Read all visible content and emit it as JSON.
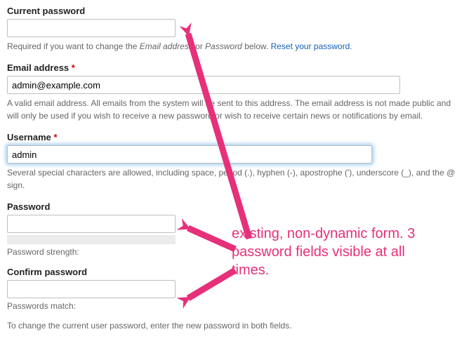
{
  "form": {
    "currentPassword": {
      "label": "Current password",
      "value": "",
      "desc_prefix": "Required if you want to change the ",
      "desc_em1": "Email address",
      "desc_mid": " or ",
      "desc_em2": "Password",
      "desc_suffix": " below. ",
      "resetLink": "Reset your password",
      "resetTail": "."
    },
    "email": {
      "label": "Email address",
      "value": "admin@example.com",
      "desc": "A valid email address. All emails from the system will be sent to this address. The email address is not made public and will only be used if you wish to receive a new password or wish to receive certain news or notifications by email."
    },
    "username": {
      "label": "Username",
      "value": "admin",
      "desc": "Several special characters are allowed, including space, period (.), hyphen (-), apostrophe ('), underscore (_), and the @ sign."
    },
    "password": {
      "label": "Password",
      "value": "",
      "strengthLabel": "Password strength:"
    },
    "confirm": {
      "label": "Confirm password",
      "value": "",
      "matchLabel": "Passwords match:"
    },
    "finalNote": "To change the current user password, enter the new password in both fields.",
    "requiredMarker": "*"
  },
  "annotation": {
    "text": "existing, non-dynamic form. 3 password fields visible at all times."
  }
}
